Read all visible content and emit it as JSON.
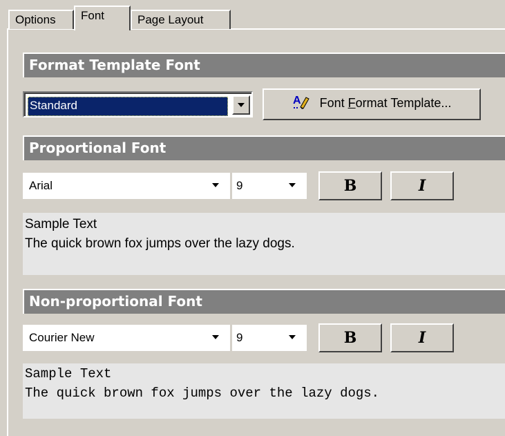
{
  "tabs": [
    {
      "label": "Options"
    },
    {
      "label": "Font"
    },
    {
      "label": "Page Layout"
    }
  ],
  "format_template": {
    "header": "Format Template Font",
    "selected_value": "Standard",
    "button_label_prefix": "Font ",
    "button_label_accel": "F",
    "button_label_suffix": "ormat Template...",
    "button_icon": "font-format-icon"
  },
  "proportional": {
    "header": "Proportional Font",
    "font_value": "Arial",
    "size_value": "9",
    "bold_label": "B",
    "italic_label": "I",
    "sample_title": "Sample Text",
    "sample_text": "The quick brown fox jumps over the lazy dogs."
  },
  "non_proportional": {
    "header": "Non-proportional Font",
    "font_value": "Courier New",
    "size_value": "9",
    "bold_label": "B",
    "italic_label": "I",
    "sample_title": "Sample Text",
    "sample_text": "The quick brown fox jumps over the lazy dogs."
  },
  "colors": {
    "dialog_bg": "#d4d0c8",
    "header_bg": "#808080",
    "selection_bg": "#0a246a",
    "sample_bg": "#e6e6e6"
  }
}
